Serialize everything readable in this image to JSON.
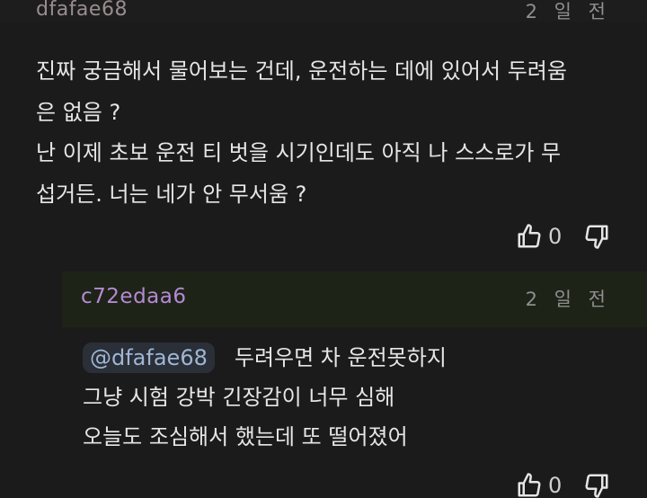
{
  "comment": {
    "username": "dfafae68",
    "time": "2 일 전",
    "lines": [
      "진짜 궁금해서 물어보는 건데, 운전하는 데에 있어서 두려움",
      "은 없음 ?",
      "난 이제 초보 운전 티 벗을 시기인데도 아직 나 스스로가 무",
      "섭거든. 너는 네가 안 무서움 ?"
    ],
    "like_count": "0",
    "like_icon": "thumbs-up-icon",
    "dislike_icon": "thumbs-down-icon"
  },
  "reply": {
    "username": "c72edaa6",
    "time": "2 일 전",
    "mention": "@dfafae68",
    "lines": [
      "두려우면 차 운전못하지",
      "그냥 시험 강박 긴장감이 너무 심해",
      "오늘도 조심해서 했는데 또 떨어졌어"
    ],
    "like_count": "0"
  },
  "colors": {
    "background": "#1b1b1b",
    "reply_header_bg": "#1e2317",
    "reply_username": "#b48ad4",
    "mention_bg": "#2a2f38",
    "mention_text": "#9fb6d4"
  }
}
